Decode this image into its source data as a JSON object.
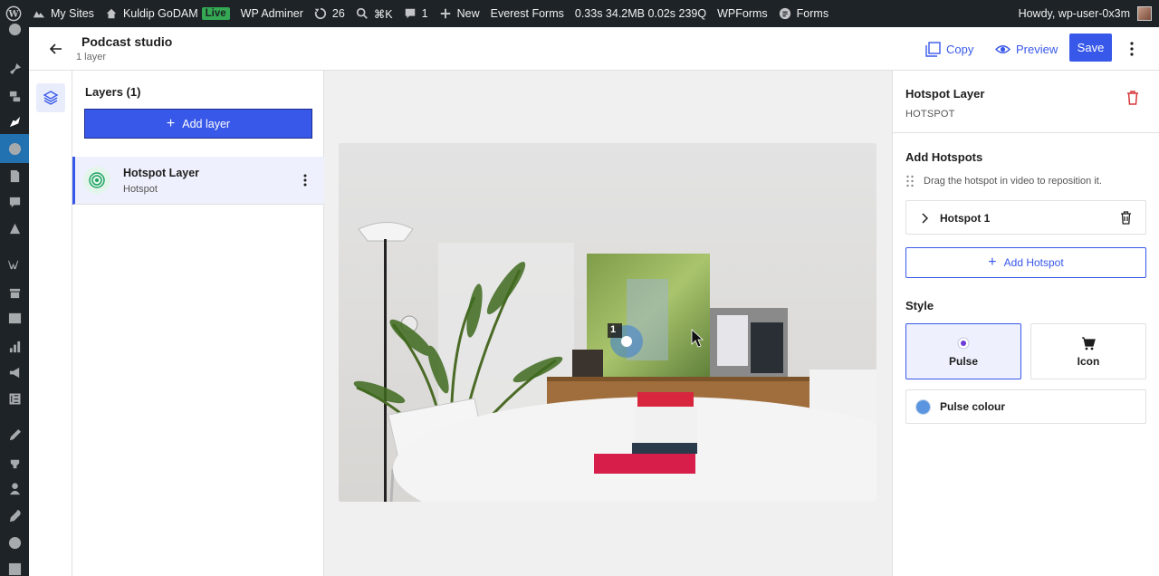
{
  "adminbar": {
    "my_sites": "My Sites",
    "site_name": "Kuldip GoDAM",
    "live": "Live",
    "wp_adminer": "WP Adminer",
    "updates_count": "26",
    "shortcut": "⌘K",
    "comments_count": "1",
    "new_label": "New",
    "everest_forms": "Everest Forms",
    "perf": "0.33s  34.2MB  0.02s  239Q",
    "wpforms": "WPForms",
    "forms": "Forms",
    "howdy": "Howdy, wp-user-0x3m"
  },
  "header": {
    "title": "Podcast studio",
    "subtitle": "1 layer",
    "copy_label": "Copy",
    "preview_label": "Preview",
    "save_label": "Save"
  },
  "layers": {
    "title": "Layers (1)",
    "add_layer_label": "Add layer",
    "items": [
      {
        "name": "Hotspot Layer",
        "type": "Hotspot"
      }
    ]
  },
  "video": {
    "hotspot_number": "1"
  },
  "settings": {
    "title": "Hotspot Layer",
    "subtitle": "HOTSPOT",
    "add_hotspots_title": "Add Hotspots",
    "drag_hint": "Drag the hotspot in video to reposition it.",
    "hotspots": [
      {
        "label": "Hotspot 1"
      }
    ],
    "add_hotspot_label": "Add Hotspot",
    "style_title": "Style",
    "style_options": [
      {
        "label": "Pulse",
        "selected": true
      },
      {
        "label": "Icon",
        "selected": false
      }
    ],
    "pulse_colour_label": "Pulse colour",
    "pulse_colour": "#5b95e0"
  },
  "colors": {
    "accent": "#3858e9",
    "danger": "#d63638",
    "admin_bar": "#1d2327"
  }
}
